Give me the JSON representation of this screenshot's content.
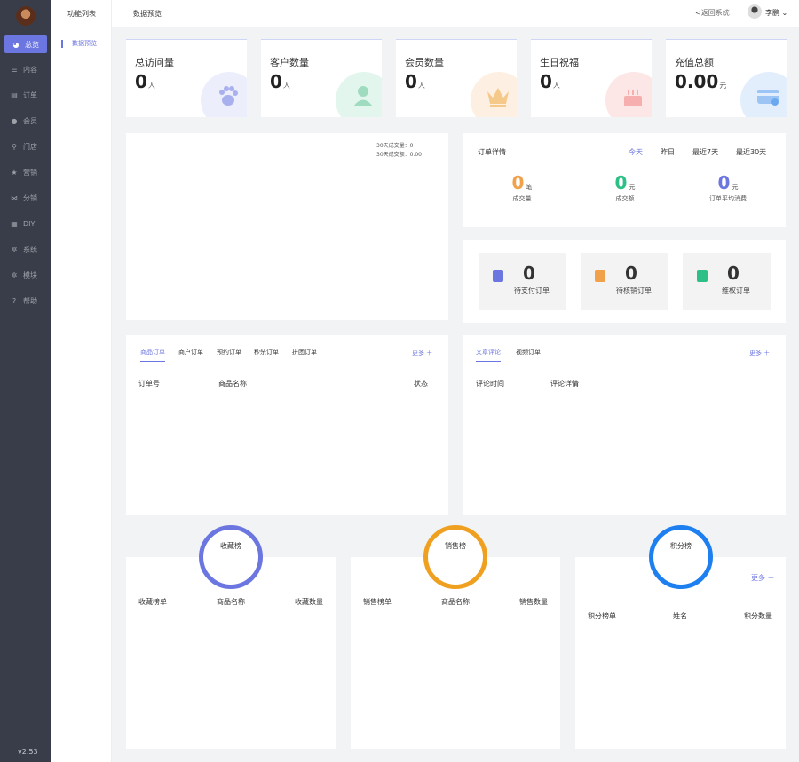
{
  "sidebar": {
    "items": [
      {
        "icon": "pie-icon",
        "glyph": "◕",
        "label": "总览"
      },
      {
        "icon": "list-icon",
        "glyph": "☰",
        "label": "内容"
      },
      {
        "icon": "document-icon",
        "glyph": "▤",
        "label": "订单"
      },
      {
        "icon": "user-icon",
        "glyph": "●",
        "label": "会员"
      },
      {
        "icon": "location-icon",
        "glyph": "⚲",
        "label": "门店"
      },
      {
        "icon": "star-icon",
        "glyph": "★",
        "label": "营销"
      },
      {
        "icon": "share-icon",
        "glyph": "⋈",
        "label": "分销"
      },
      {
        "icon": "diy-icon",
        "glyph": "▦",
        "label": "DIY"
      },
      {
        "icon": "gear-icon",
        "glyph": "✲",
        "label": "系统"
      },
      {
        "icon": "module-icon",
        "glyph": "✲",
        "label": "模块"
      },
      {
        "icon": "help-icon",
        "glyph": "?",
        "label": "帮助"
      }
    ],
    "version": "v2.53"
  },
  "subnav": {
    "title": "功能列表",
    "item": "数据预览"
  },
  "topbar": {
    "breadcrumb": "数据预览",
    "back": "<返回系统",
    "username": "李鹏",
    "dropdown": "⌄"
  },
  "stats": [
    {
      "label": "总访问量",
      "value": "0",
      "unit": "人",
      "icon": "paw-icon",
      "color": "#6c76e0",
      "bg": "#eceefb"
    },
    {
      "label": "客户数量",
      "value": "0",
      "unit": "人",
      "icon": "users-icon",
      "color": "#2cbf86",
      "bg": "#e3f6ee"
    },
    {
      "label": "会员数量",
      "value": "0",
      "unit": "人",
      "icon": "crown-icon",
      "color": "#f0a14a",
      "bg": "#fdf0e2"
    },
    {
      "label": "生日祝福",
      "value": "0",
      "unit": "人",
      "icon": "cake-icon",
      "color": "#f08a8a",
      "bg": "#fde6e6"
    },
    {
      "label": "充值总额",
      "value": "0.00",
      "unit": "元",
      "icon": "card-icon",
      "color": "#4a90e2",
      "bg": "#e2eefc"
    }
  ],
  "trend": {
    "line1": "30天成交量：0",
    "line2": "30天成交额：0.00"
  },
  "order_detail": {
    "title": "订单详情",
    "tabs": [
      "今天",
      "昨日",
      "最近7天",
      "最近30天"
    ],
    "metrics": [
      {
        "value": "0",
        "unit": "笔",
        "label": "成交量",
        "color": "#f0a14a"
      },
      {
        "value": "0",
        "unit": "元",
        "label": "成交额",
        "color": "#2cbf86"
      },
      {
        "value": "0",
        "unit": "元",
        "label": "订单平均消费",
        "color": "#6c76e0"
      }
    ]
  },
  "todos": [
    {
      "value": "0",
      "label": "待支付订单",
      "icon": "pay-icon",
      "color": "#6c76e0"
    },
    {
      "value": "0",
      "label": "待核销订单",
      "icon": "verify-icon",
      "color": "#f0a14a"
    },
    {
      "value": "0",
      "label": "维权订单",
      "icon": "rights-icon",
      "color": "#2cbf86"
    }
  ],
  "orders_panel": {
    "tabs": [
      "商品订单",
      "商户订单",
      "预约订单",
      "秒杀订单",
      "拼团订单"
    ],
    "more": "更多 ＋",
    "columns": [
      "订单号",
      "商品名称",
      "状态"
    ]
  },
  "comments_panel": {
    "tabs": [
      "文章评论",
      "视频订单"
    ],
    "more": "更多 ＋",
    "columns": [
      "评论时间",
      "评论详情"
    ]
  },
  "rankings": [
    {
      "title": "收藏榜",
      "color": "#6c76e0",
      "columns": [
        "收藏榜单",
        "商品名称",
        "收藏数量"
      ],
      "more": ""
    },
    {
      "title": "销售榜",
      "color": "#f0a020",
      "columns": [
        "销售榜单",
        "商品名称",
        "销售数量"
      ],
      "more": ""
    },
    {
      "title": "积分榜",
      "color": "#1e7ff0",
      "columns": [
        "积分榜单",
        "姓名",
        "积分数量"
      ],
      "more": "更多 ＋"
    }
  ]
}
